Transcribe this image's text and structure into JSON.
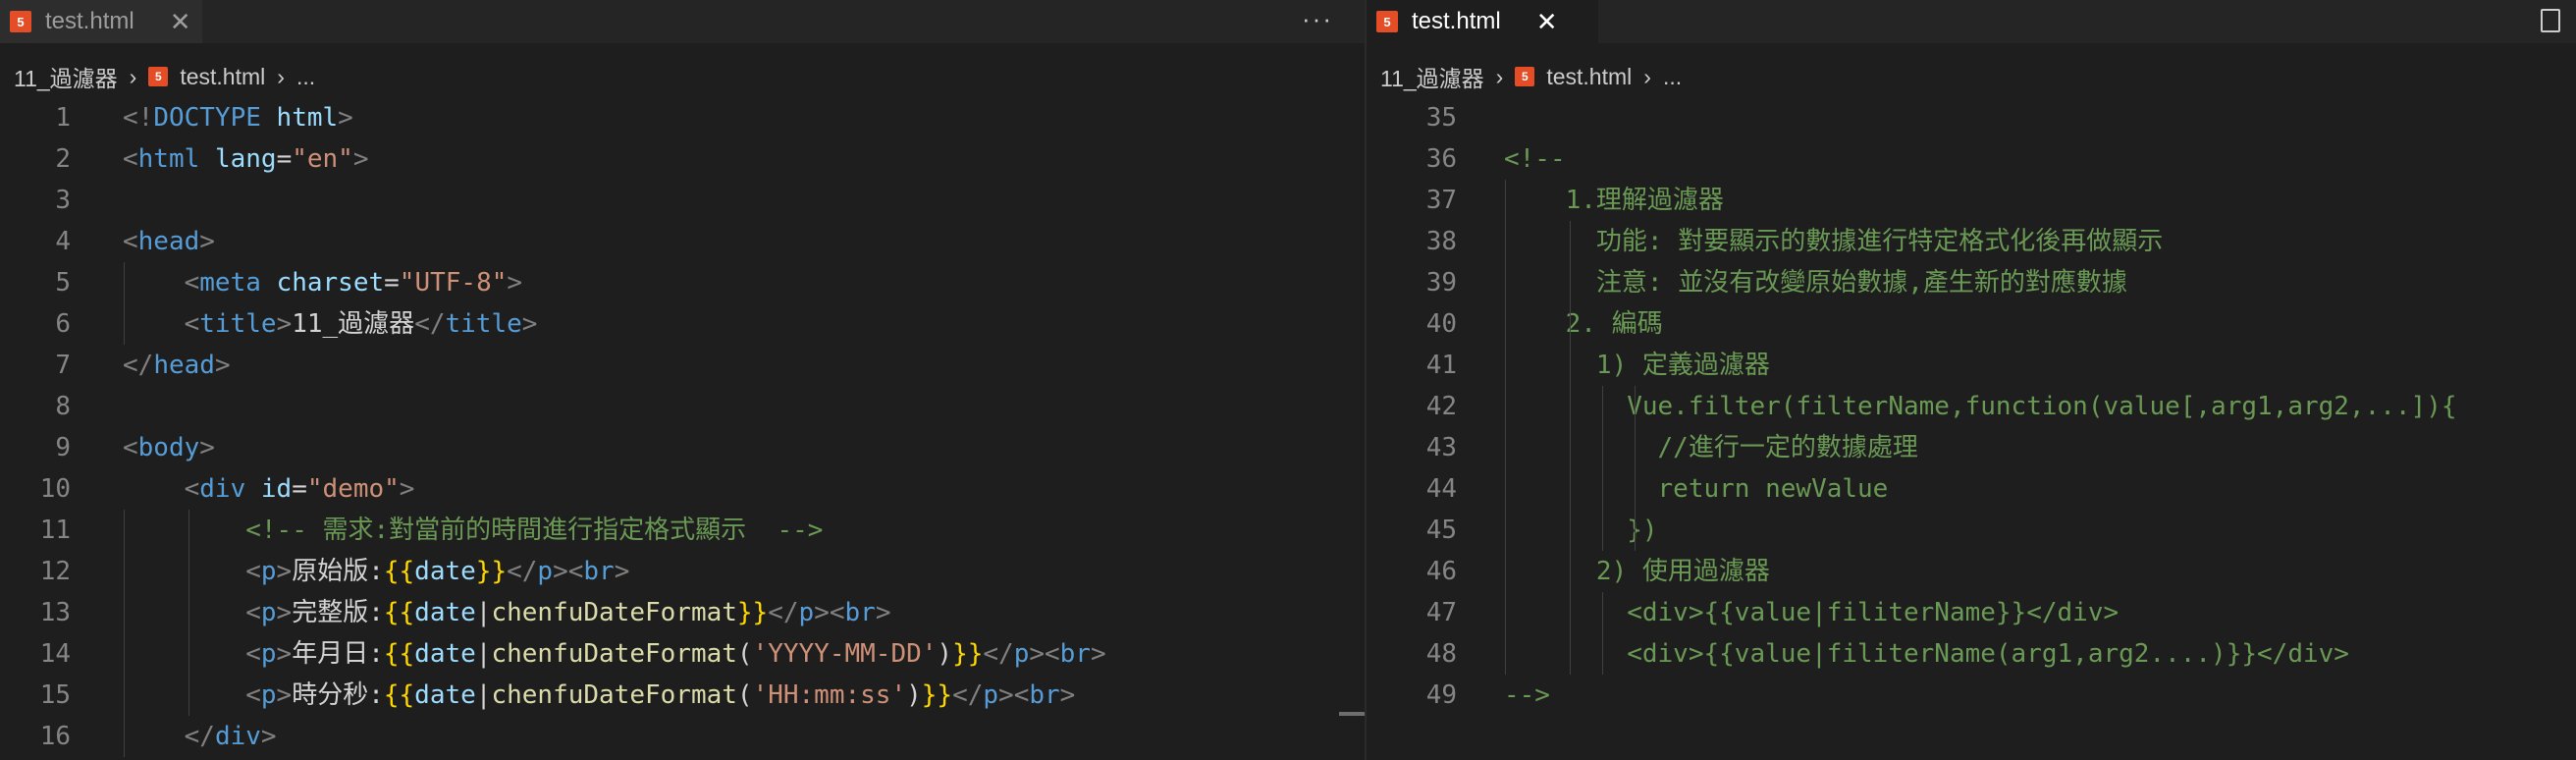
{
  "left_pane": {
    "tab": {
      "icon": "html5-icon",
      "title": "test.html",
      "close": "✕",
      "more": "···"
    },
    "breadcrumb": {
      "folder": "11_過濾器",
      "file_icon": "html5-icon",
      "file": "test.html",
      "rest": "..."
    },
    "lines": [
      {
        "n": "1",
        "t": [
          [
            "g",
            "<!"
          ],
          [
            "k",
            "DOCTYPE"
          ],
          [
            "x",
            " "
          ],
          [
            "a",
            "html"
          ],
          [
            "g",
            ">"
          ]
        ]
      },
      {
        "n": "2",
        "t": [
          [
            "g",
            "<"
          ],
          [
            "k",
            "html"
          ],
          [
            "x",
            " "
          ],
          [
            "a",
            "lang"
          ],
          [
            "x",
            "="
          ],
          [
            "s",
            "\"en\""
          ],
          [
            "g",
            ">"
          ]
        ]
      },
      {
        "n": "3",
        "t": []
      },
      {
        "n": "4",
        "t": [
          [
            "g",
            "<"
          ],
          [
            "k",
            "head"
          ],
          [
            "g",
            ">"
          ]
        ]
      },
      {
        "n": "5",
        "t": [
          [
            "x",
            "    "
          ],
          [
            "g",
            "<"
          ],
          [
            "k",
            "meta"
          ],
          [
            "x",
            " "
          ],
          [
            "a",
            "charset"
          ],
          [
            "x",
            "="
          ],
          [
            "s",
            "\"UTF-8\""
          ],
          [
            "g",
            ">"
          ]
        ]
      },
      {
        "n": "6",
        "t": [
          [
            "x",
            "    "
          ],
          [
            "g",
            "<"
          ],
          [
            "k",
            "title"
          ],
          [
            "g",
            ">"
          ],
          [
            "x",
            "11_過濾器"
          ],
          [
            "g",
            "</"
          ],
          [
            "k",
            "title"
          ],
          [
            "g",
            ">"
          ]
        ]
      },
      {
        "n": "7",
        "t": [
          [
            "g",
            "</"
          ],
          [
            "k",
            "head"
          ],
          [
            "g",
            ">"
          ]
        ]
      },
      {
        "n": "8",
        "t": []
      },
      {
        "n": "9",
        "t": [
          [
            "g",
            "<"
          ],
          [
            "k",
            "body"
          ],
          [
            "g",
            ">"
          ]
        ]
      },
      {
        "n": "10",
        "t": [
          [
            "x",
            "    "
          ],
          [
            "g",
            "<"
          ],
          [
            "k",
            "div"
          ],
          [
            "x",
            " "
          ],
          [
            "a",
            "id"
          ],
          [
            "x",
            "="
          ],
          [
            "s",
            "\"demo\""
          ],
          [
            "g",
            ">"
          ]
        ]
      },
      {
        "n": "11",
        "t": [
          [
            "x",
            "        "
          ],
          [
            "c",
            "<!-- 需求:對當前的時間進行指定格式顯示  -->"
          ]
        ]
      },
      {
        "n": "12",
        "t": [
          [
            "x",
            "        "
          ],
          [
            "g",
            "<"
          ],
          [
            "k",
            "p"
          ],
          [
            "g",
            ">"
          ],
          [
            "x",
            "原始版:"
          ],
          [
            "b",
            "{{"
          ],
          [
            "a",
            "date"
          ],
          [
            "b",
            "}}"
          ],
          [
            "g",
            "</"
          ],
          [
            "k",
            "p"
          ],
          [
            "g",
            "><"
          ],
          [
            "k",
            "br"
          ],
          [
            "g",
            ">"
          ]
        ]
      },
      {
        "n": "13",
        "t": [
          [
            "x",
            "        "
          ],
          [
            "g",
            "<"
          ],
          [
            "k",
            "p"
          ],
          [
            "g",
            ">"
          ],
          [
            "x",
            "完整版:"
          ],
          [
            "b",
            "{{"
          ],
          [
            "a",
            "date"
          ],
          [
            "x",
            "|"
          ],
          [
            "f",
            "chenfuDateFormat"
          ],
          [
            "b",
            "}}"
          ],
          [
            "g",
            "</"
          ],
          [
            "k",
            "p"
          ],
          [
            "g",
            "><"
          ],
          [
            "k",
            "br"
          ],
          [
            "g",
            ">"
          ]
        ]
      },
      {
        "n": "14",
        "t": [
          [
            "x",
            "        "
          ],
          [
            "g",
            "<"
          ],
          [
            "k",
            "p"
          ],
          [
            "g",
            ">"
          ],
          [
            "x",
            "年月日:"
          ],
          [
            "b",
            "{{"
          ],
          [
            "a",
            "date"
          ],
          [
            "x",
            "|"
          ],
          [
            "f",
            "chenfuDateFormat"
          ],
          [
            "x",
            "("
          ],
          [
            "s",
            "'YYYY-MM-DD'"
          ],
          [
            "x",
            ")"
          ],
          [
            "b",
            "}}"
          ],
          [
            "g",
            "</"
          ],
          [
            "k",
            "p"
          ],
          [
            "g",
            "><"
          ],
          [
            "k",
            "br"
          ],
          [
            "g",
            ">"
          ]
        ]
      },
      {
        "n": "15",
        "t": [
          [
            "x",
            "        "
          ],
          [
            "g",
            "<"
          ],
          [
            "k",
            "p"
          ],
          [
            "g",
            ">"
          ],
          [
            "x",
            "時分秒:"
          ],
          [
            "b",
            "{{"
          ],
          [
            "a",
            "date"
          ],
          [
            "x",
            "|"
          ],
          [
            "f",
            "chenfuDateFormat"
          ],
          [
            "x",
            "("
          ],
          [
            "s",
            "'HH:mm:ss'"
          ],
          [
            "x",
            ")"
          ],
          [
            "b",
            "}}"
          ],
          [
            "g",
            "</"
          ],
          [
            "k",
            "p"
          ],
          [
            "g",
            "><"
          ],
          [
            "k",
            "br"
          ],
          [
            "g",
            ">"
          ]
        ]
      },
      {
        "n": "16",
        "t": [
          [
            "x",
            "    "
          ],
          [
            "g",
            "</"
          ],
          [
            "k",
            "div"
          ],
          [
            "g",
            ">"
          ]
        ]
      }
    ]
  },
  "right_pane": {
    "tab": {
      "icon": "html5-icon",
      "title": "test.html",
      "close": "✕"
    },
    "breadcrumb": {
      "folder": "11_過濾器",
      "file_icon": "html5-icon",
      "file": "test.html",
      "rest": "..."
    },
    "lines": [
      {
        "n": "35",
        "t": []
      },
      {
        "n": "36",
        "t": [
          [
            "c",
            "<!--"
          ]
        ]
      },
      {
        "n": "37",
        "t": [
          [
            "c",
            "    1.理解過濾器"
          ]
        ]
      },
      {
        "n": "38",
        "t": [
          [
            "c",
            "      功能: 對要顯示的數據進行特定格式化後再做顯示"
          ]
        ]
      },
      {
        "n": "39",
        "t": [
          [
            "c",
            "      注意: 並沒有改變原始數據,產生新的對應數據"
          ]
        ]
      },
      {
        "n": "40",
        "t": [
          [
            "c",
            "    2. 編碼"
          ]
        ]
      },
      {
        "n": "41",
        "t": [
          [
            "c",
            "      1) 定義過濾器"
          ]
        ]
      },
      {
        "n": "42",
        "t": [
          [
            "c",
            "        Vue.filter(filterName,function(value[,arg1,arg2,...]){"
          ]
        ]
      },
      {
        "n": "43",
        "t": [
          [
            "c",
            "          //進行一定的數據處理"
          ]
        ]
      },
      {
        "n": "44",
        "t": [
          [
            "c",
            "          return newValue"
          ]
        ]
      },
      {
        "n": "45",
        "t": [
          [
            "c",
            "        })"
          ]
        ]
      },
      {
        "n": "46",
        "t": [
          [
            "c",
            "      2) 使用過濾器"
          ]
        ]
      },
      {
        "n": "47",
        "t": [
          [
            "c",
            "        <div>{{value|filiterName}}</div>"
          ]
        ]
      },
      {
        "n": "48",
        "t": [
          [
            "c",
            "        <div>{{value|filiterName(arg1,arg2....)}}</div>"
          ]
        ]
      },
      {
        "n": "49",
        "t": [
          [
            "c",
            "-->"
          ]
        ]
      }
    ]
  },
  "colors": {
    "background": "#1e1e1e",
    "tab_bar": "#252526",
    "html_icon": "#e44d26",
    "tag": "#569cd6",
    "attribute": "#9cdcfe",
    "string": "#ce9178",
    "comment": "#6a9955",
    "brace": "#ffd700",
    "function": "#dcdcaa",
    "punctuation": "#808080"
  }
}
